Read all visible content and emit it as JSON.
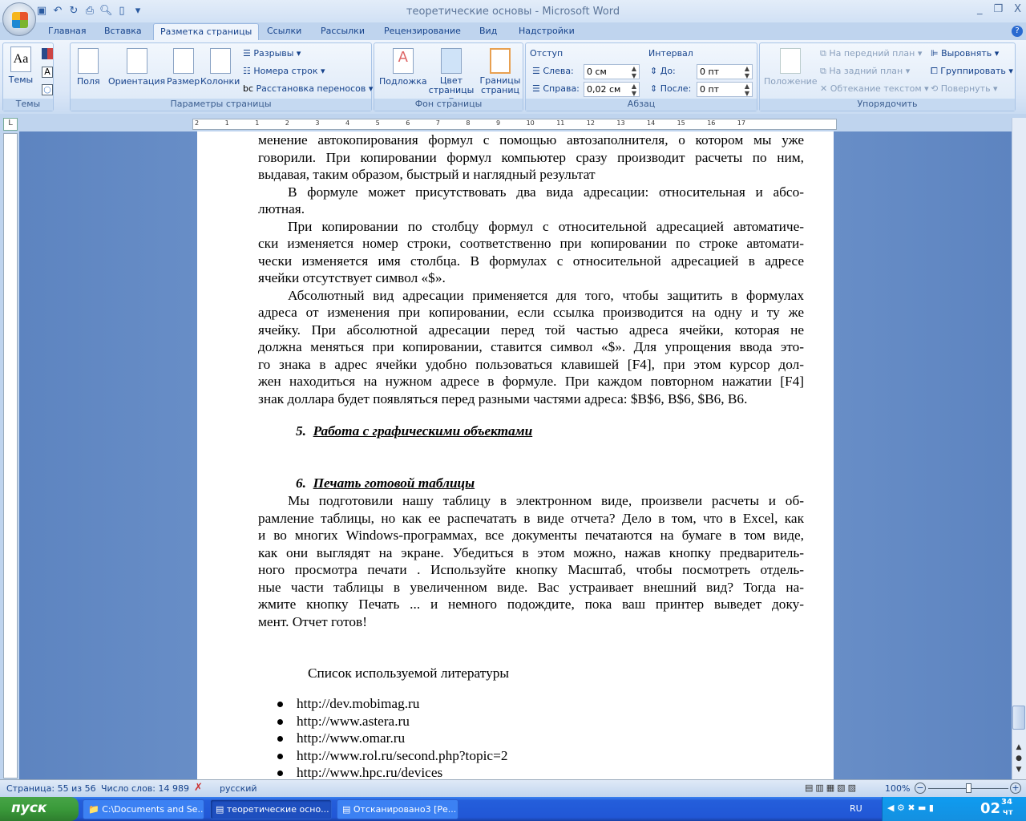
{
  "window": {
    "title": "теоретические основы - Microsoft Word",
    "minimize": "_",
    "restore": "❐",
    "close": "X"
  },
  "qat": [
    "save-icon",
    "undo-icon",
    "redo-icon",
    "print-icon",
    "preview-icon",
    "new-icon"
  ],
  "tabs": [
    "Главная",
    "Вставка",
    "Разметка страницы",
    "Ссылки",
    "Рассылки",
    "Рецензирование",
    "Вид",
    "Надстройки"
  ],
  "ribbon": {
    "themes": {
      "label": "Темы",
      "button": "Темы"
    },
    "page_setup": {
      "label": "Параметры страницы",
      "fields": "Поля",
      "orientation": "Ориентация",
      "size": "Размер",
      "columns": "Колонки",
      "breaks": "Разрывы ▾",
      "line_numbers": "Номера строк ▾",
      "hyphenation": "Расстановка переносов ▾"
    },
    "page_background": {
      "label": "Фон страницы",
      "watermark": "Подложка",
      "page_color": "Цвет страницы ▾",
      "page_borders": "Границы страниц"
    },
    "paragraph": {
      "label": "Абзац",
      "indent": "Отступ",
      "left_label": "Слева:",
      "left_value": "0 см",
      "right_label": "Справа:",
      "right_value": "0,02 см",
      "spacing": "Интервал",
      "before_label": "До:",
      "before_value": "0 пт",
      "after_label": "После:",
      "after_value": "0 пт"
    },
    "arrange": {
      "label": "Упорядочить",
      "position": "Положение",
      "bring_front": "На передний план ▾",
      "send_back": "На задний план ▾",
      "text_wrap": "Обтекание текстом ▾",
      "align": "Выровнять ▾",
      "group": "Группировать ▾",
      "rotate": "Повернуть ▾"
    }
  },
  "ruler": {
    "marks": [
      "2",
      "1",
      "1",
      "2",
      "3",
      "4",
      "5",
      "6",
      "7",
      "8",
      "9",
      "10",
      "11",
      "12",
      "13",
      "14",
      "15",
      "16",
      "17"
    ]
  },
  "document": {
    "lines": [
      {
        "t": "менение автокопирования формул с помощью автозаполнителя, о котором мы уже"
      },
      {
        "t": "говорили. При копировании формул компьютер сразу производит расчеты по ним,"
      },
      {
        "t": "выдавая, таким образом, быстрый и наглядный результат",
        "last": true
      },
      {
        "t": "В формуле может присутствовать два вида адресации: относительная и абсо-",
        "ind": true
      },
      {
        "t": "лютная.",
        "last": true
      },
      {
        "t": "При копировании по столбцу формул с относительной адресацией автоматиче-",
        "ind": true
      },
      {
        "t": "ски изменяется номер строки, соответственно при копировании по строке автомати-"
      },
      {
        "t": "чески изменяется имя столбца. В формулах с относительной адресацией в адресе"
      },
      {
        "t": "ячейки отсутствует символ «$».",
        "last": true
      },
      {
        "t": "Абсолютный вид адресации применяется для того, чтобы защитить в формулах",
        "ind": true
      },
      {
        "t": "адреса от изменения при копировании, если ссылка производится на одну и ту же"
      },
      {
        "t": "ячейку. При абсолютной адресации перед той частью адреса ячейки, которая не"
      },
      {
        "t": "должна меняться при копировании, ставится символ «$». Для упрощения ввода это-"
      },
      {
        "t": "го знака в адрес ячейки удобно пользоваться клавишей [F4], при этом курсор дол-"
      },
      {
        "t": "жен находиться на нужном адресе в формуле. При каждом повторном нажатии [F4]"
      },
      {
        "t": "знак доллара будет появляться перед разными частями адреса: $B$6, B$6, $B6, B6.",
        "last": true
      }
    ],
    "heading5_num": "5.",
    "heading5": "Работа с графическими объектами",
    "heading6_num": "6.",
    "heading6": "Печать готовой таблицы",
    "lines2": [
      {
        "t": "Мы подготовили нашу таблицу в электронном виде, произвели расчеты и об-",
        "ind": true
      },
      {
        "t": "рамление таблицы, но как ее распечатать в виде отчета? Дело в том, что в Excel, как"
      },
      {
        "t": "и во многих Windows-программах, все документы печатаются на бумаге в том виде,"
      },
      {
        "t": "как они выглядят на экране. Убедиться в этом можно, нажав кнопку предваритель-"
      },
      {
        "t": "ного просмотра печати . Используйте кнопку Масштаб, чтобы посмотреть отдель-"
      },
      {
        "t": "ные части таблицы в увеличенном виде. Вас устраивает внешний вид? Тогда на-"
      },
      {
        "t": "жмите кнопку Печать ... и немного подождите, пока ваш принтер выведет доку-"
      },
      {
        "t": "мент. Отчет готов!",
        "last": true
      }
    ],
    "references_title": "Список используемой литературы",
    "references": [
      "http://dev.mobimag.ru",
      "http://www.astera.ru",
      "http://www.omar.ru",
      "http://www.rol.ru/second.php?topic=2",
      "http://www.hpc.ru/devices"
    ]
  },
  "status": {
    "page": "Страница: 55 из 56",
    "words": "Число слов: 14 989",
    "language": "русский",
    "zoom": "100%",
    "zoom_level": 100
  },
  "taskbar": {
    "start": "пуск",
    "items": [
      "C:\\Documents and Se...",
      "теоретические осно...",
      "Отсканировано3 [Ре..."
    ],
    "lang": "RU",
    "time": "02",
    "time_min": "34",
    "day": "чт"
  }
}
